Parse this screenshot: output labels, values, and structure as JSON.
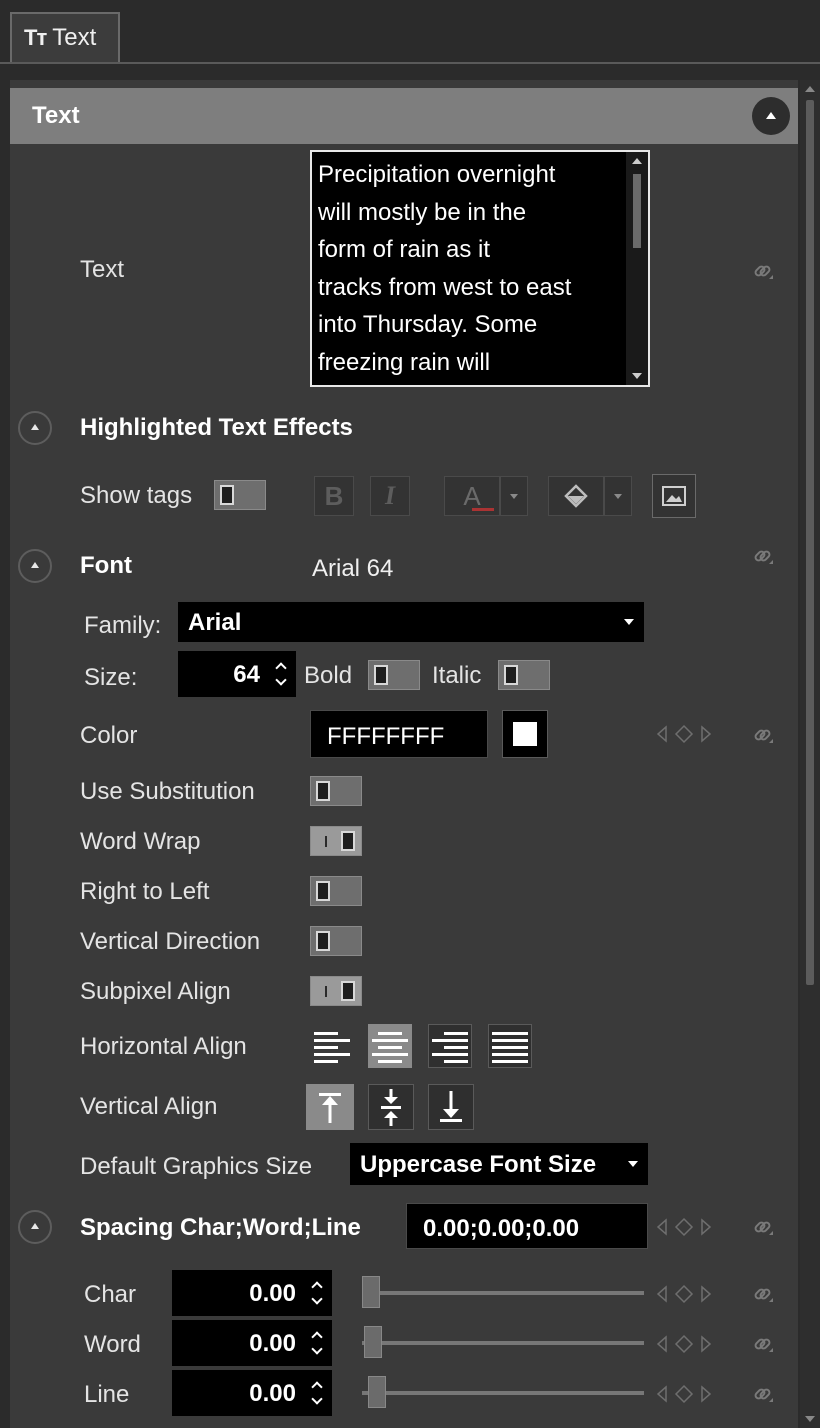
{
  "tab": {
    "icon": "text-tt-icon",
    "label": "Text",
    "icon_glyph": "Tт"
  },
  "section": {
    "title": "Text"
  },
  "text_prop": {
    "label": "Text",
    "value": "Precipitation overnight\nwill mostly be in the\nform of rain as it\ntracks from west to east\ninto Thursday. Some\nfreezing rain will"
  },
  "highlighted": {
    "title": "Highlighted Text Effects",
    "show_tags_label": "Show tags",
    "bold_glyph": "B",
    "italic_glyph": "I",
    "font_color_glyph": "A"
  },
  "font": {
    "title": "Font",
    "summary": "Arial 64",
    "family_label": "Family:",
    "family_value": "Arial",
    "size_label": "Size:",
    "size_value": "64",
    "bold_label": "Bold",
    "italic_label": "Italic"
  },
  "color": {
    "label": "Color",
    "value": "FFFFFFFF",
    "swatch": "#ffffff"
  },
  "toggles": [
    {
      "label": "Use Substitution",
      "state": "off"
    },
    {
      "label": "Word Wrap",
      "state": "on"
    },
    {
      "label": "Right to Left",
      "state": "off"
    },
    {
      "label": "Vertical Direction",
      "state": "off"
    },
    {
      "label": "Subpixel Align",
      "state": "on"
    }
  ],
  "horizontal_align": {
    "label": "Horizontal Align",
    "selected": "center"
  },
  "vertical_align": {
    "label": "Vertical Align",
    "selected": "top"
  },
  "default_graphics": {
    "label": "Default Graphics Size",
    "value": "Uppercase Font Size"
  },
  "spacing": {
    "title": "Spacing Char;Word;Line",
    "value": "0.00;0.00;0.00",
    "rows": [
      {
        "label": "Char",
        "value": "0.00"
      },
      {
        "label": "Word",
        "value": "0.00"
      },
      {
        "label": "Line",
        "value": "0.00"
      }
    ]
  }
}
